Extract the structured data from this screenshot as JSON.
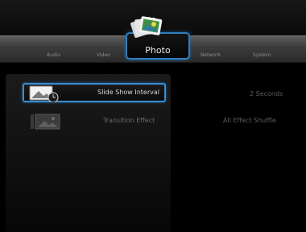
{
  "tabs": {
    "audio": "Audio",
    "video": "Video",
    "photo": "Photo",
    "network": "Network",
    "system": "System"
  },
  "settings": [
    {
      "label": "Slide Show Interval",
      "value": "2 Seconds",
      "icon": "slideshow-clock-icon"
    },
    {
      "label": "Transition Effect",
      "value": "All Effect Shuffle",
      "icon": "transition-image-icon"
    }
  ],
  "colors": {
    "accent": "#3a8dd0",
    "tabbar": "#4a4a4a"
  }
}
